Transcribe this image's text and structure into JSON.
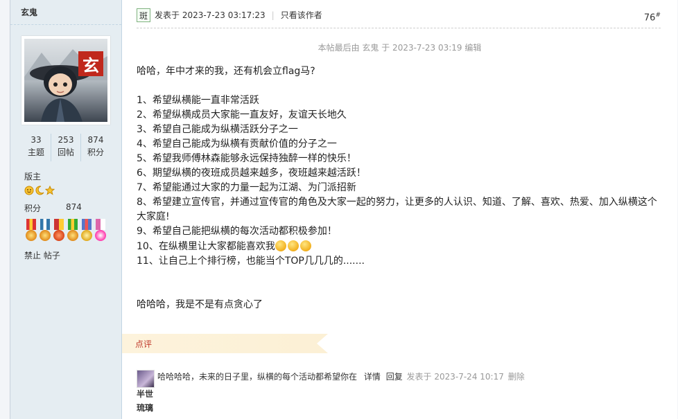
{
  "sidebar": {
    "username": "玄鬼",
    "avatar_badge": "玄",
    "stats": [
      {
        "value": "33",
        "label": "主题"
      },
      {
        "value": "253",
        "label": "回帖"
      },
      {
        "value": "874",
        "label": "积分"
      }
    ],
    "rank": "版主",
    "points_label": "积分",
    "points_value": "874",
    "ban_label": "禁止 帖子"
  },
  "post": {
    "author_icon_text": "斑",
    "posted_at": "发表于 2023-7-23 03:17:23",
    "only_author": "只看该作者",
    "floor": "76",
    "floor_sup": "#",
    "edit_note": "本帖最后由 玄鬼 于 2023-7-23 03:19 编辑",
    "intro": "哈哈，年中才来的我，还有机会立flag马?",
    "lines": [
      "1、希望纵横能一直非常活跃",
      "2、希望纵横成员大家能一直友好，友谊天长地久",
      "3、希望自己能成为纵横活跃分子之一",
      "4、希望自己能成为纵横有贡献价值的分子之一",
      "5、希望我师傅林森能够永远保持独醉一样的快乐！",
      "6、期望纵横的夜班成员越来越多，夜班越来越活跃！",
      "7、希望能通过大家的力量一起为江湖、为门派招新",
      "8、希望建立宣传官，并通过宣传官的角色及大家一起的努力，让更多的人认识、知道、了解、喜欢、热爱、加入纵横这个大家庭!",
      "9、希望自己能把纵横的每次活动都积极参加！"
    ],
    "line10": "10、在纵横里让大家都能喜欢我",
    "line11": "11、让自己上个排行榜，也能当个TOP几几几的.......",
    "closing": "哈哈哈，我是不是有点贪心了"
  },
  "comments": {
    "header": "点评",
    "items": [
      {
        "author": "半世琉璃",
        "author_line1": "半世",
        "author_line2": "琉璃",
        "text": "哈哈哈哈，未来的日子里，纵横的每个活动都希望你在",
        "detail": "详情",
        "reply": "回复",
        "time": "发表于 2023-7-24 10:17",
        "delete": "删除"
      }
    ]
  },
  "colors": {
    "sidebar_bg": "#e5edf2",
    "comment_header": "#c0392b",
    "comment_bar_bg": "#fdf3dc"
  }
}
